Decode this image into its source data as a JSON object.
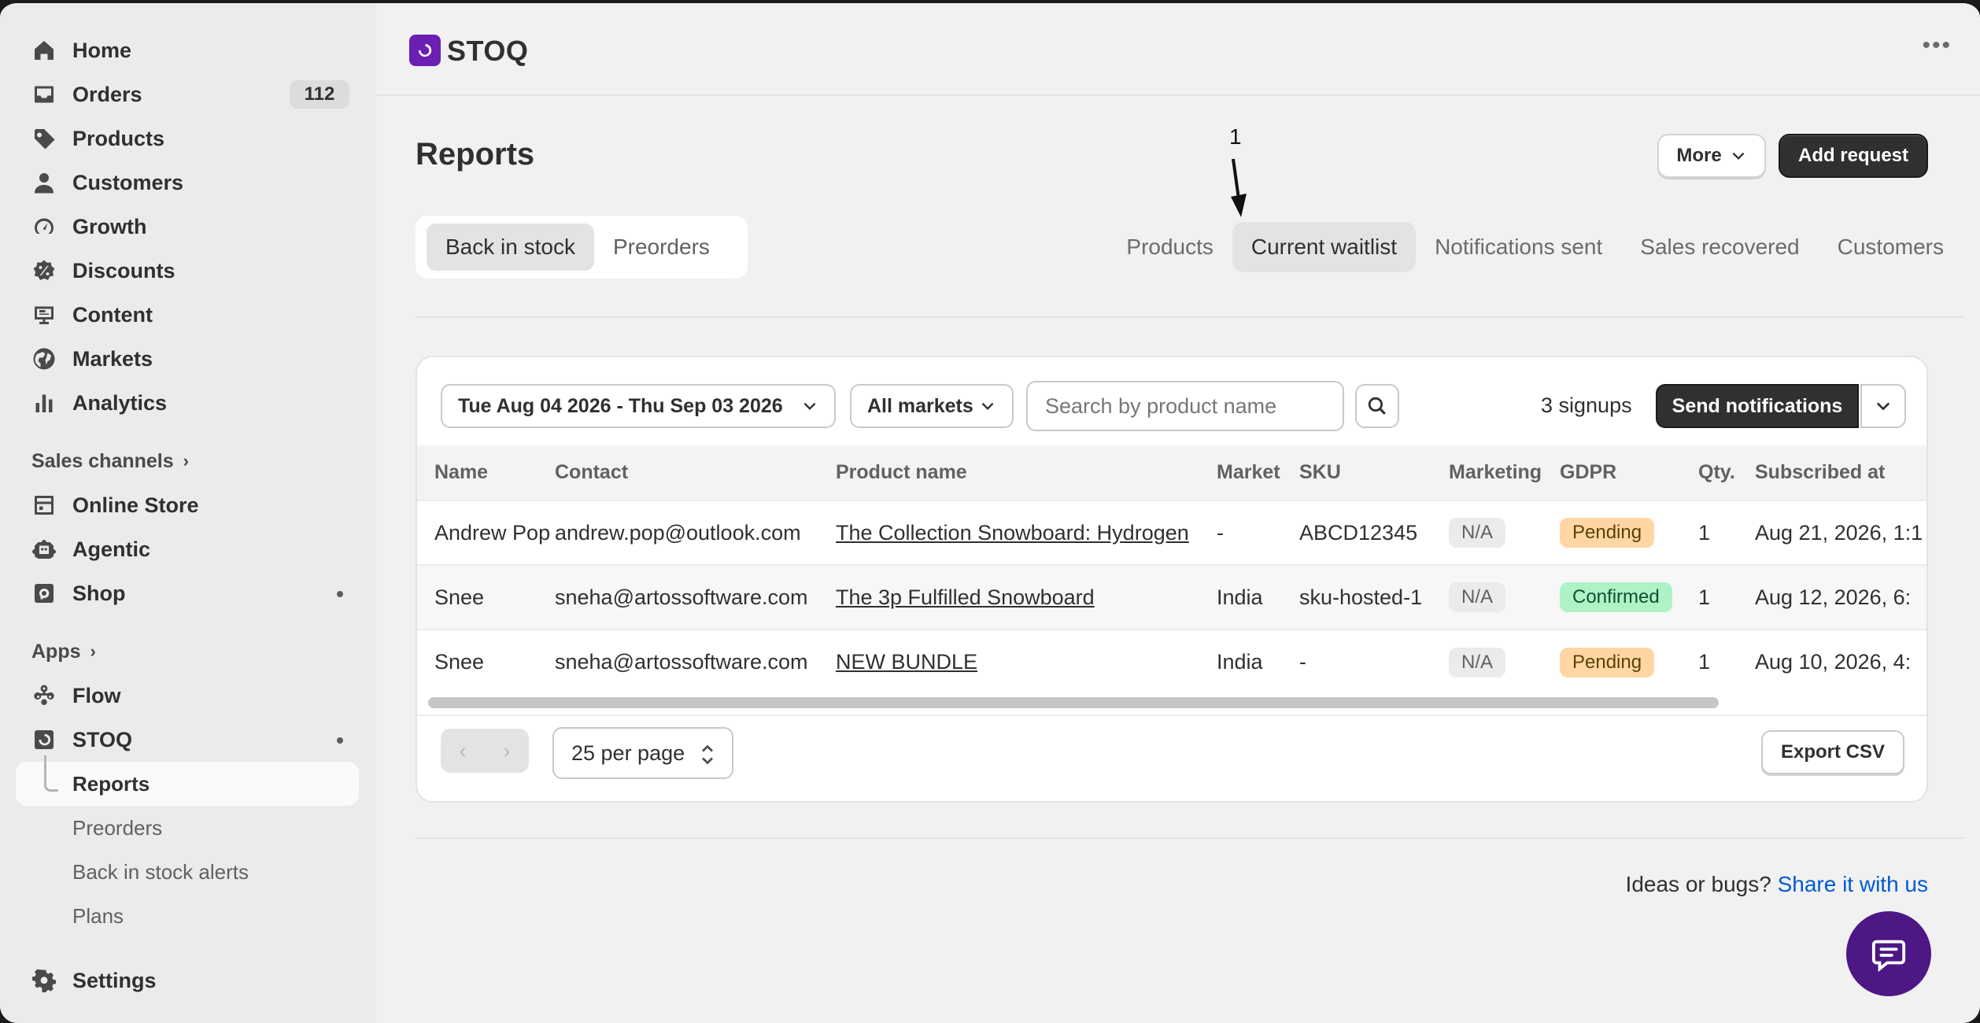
{
  "sidebar": {
    "items": [
      {
        "label": "Home",
        "icon": "home-icon"
      },
      {
        "label": "Orders",
        "icon": "inbox-icon",
        "badge": "112"
      },
      {
        "label": "Products",
        "icon": "tag-icon"
      },
      {
        "label": "Customers",
        "icon": "person-icon"
      },
      {
        "label": "Growth",
        "icon": "gauge-icon"
      },
      {
        "label": "Discounts",
        "icon": "discount-icon"
      },
      {
        "label": "Content",
        "icon": "content-icon"
      },
      {
        "label": "Markets",
        "icon": "globe-icon"
      },
      {
        "label": "Analytics",
        "icon": "bar-chart-icon"
      }
    ],
    "sales_channels_label": "Sales channels",
    "channels": [
      {
        "label": "Online Store",
        "icon": "store-icon"
      },
      {
        "label": "Agentic",
        "icon": "agentic-icon"
      },
      {
        "label": "Shop",
        "icon": "shop-icon"
      }
    ],
    "apps_label": "Apps",
    "apps": [
      {
        "label": "Flow",
        "icon": "flow-icon"
      },
      {
        "label": "STOQ",
        "icon": "stoq-icon"
      }
    ],
    "stoq_subitems": [
      "Reports",
      "Preorders",
      "Back in stock alerts",
      "Plans"
    ],
    "settings_label": "Settings"
  },
  "topbar": {
    "app_name": "STOQ",
    "more_glyph": "•••"
  },
  "page": {
    "title": "Reports",
    "more_label": "More",
    "add_request_label": "Add request",
    "annotation_number": "1"
  },
  "segment": {
    "options": [
      "Back in stock",
      "Preorders"
    ],
    "selected": "Back in stock"
  },
  "tabs": {
    "items": [
      "Products",
      "Current waitlist",
      "Notifications sent",
      "Sales recovered",
      "Customers"
    ],
    "selected": "Current waitlist"
  },
  "filters": {
    "date_range": "Tue Aug 04 2026 - Thu Sep 03 2026",
    "market": "All markets",
    "search_placeholder": "Search by product name",
    "signups": "3 signups",
    "send_label": "Send notifications"
  },
  "table": {
    "columns": [
      "Name",
      "Contact",
      "Product name",
      "Market",
      "SKU",
      "Marketing",
      "GDPR",
      "Qty.",
      "Subscribed at"
    ],
    "rows": [
      {
        "name": "Andrew Pop",
        "contact": "andrew.pop@outlook.com",
        "product": "The Collection Snowboard: Hydrogen",
        "market": "-",
        "sku": "ABCD12345",
        "marketing": "N/A",
        "gdpr": "Pending",
        "qty": "1",
        "subscribed": "Aug 21, 2026, 1:1"
      },
      {
        "name": "Snee",
        "contact": "sneha@artossoftware.com",
        "product": "The 3p Fulfilled Snowboard",
        "market": "India",
        "sku": "sku-hosted-1",
        "marketing": "N/A",
        "gdpr": "Confirmed",
        "qty": "1",
        "subscribed": "Aug 12, 2026, 6:"
      },
      {
        "name": "Snee",
        "contact": "sneha@artossoftware.com",
        "product": "NEW BUNDLE",
        "market": "India",
        "sku": "-",
        "marketing": "N/A",
        "gdpr": "Pending",
        "qty": "1",
        "subscribed": "Aug 10, 2026, 4:"
      }
    ]
  },
  "footer": {
    "per_page": "25 per page",
    "export_label": "Export CSV",
    "ideas_text": "Ideas or bugs?",
    "ideas_link": "Share it with us"
  },
  "colors": {
    "accent": "#303030",
    "link": "#005bd3",
    "pending_bg": "#ffd6a4",
    "confirmed_bg": "#aff2c5",
    "chat_bg": "#4d1784",
    "stoq_logo": "#6b1fb3"
  }
}
